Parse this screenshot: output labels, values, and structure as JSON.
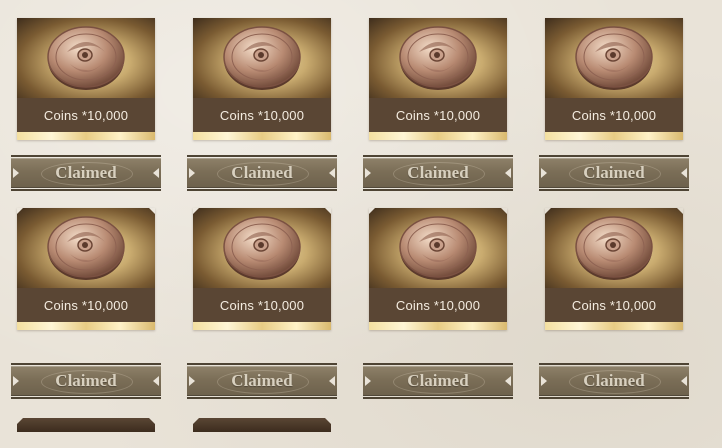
{
  "rewards": [
    {
      "label": "Coins *10,000",
      "status": "Claimed"
    },
    {
      "label": "Coins *10,000",
      "status": "Claimed"
    },
    {
      "label": "Coins *10,000",
      "status": "Claimed"
    },
    {
      "label": "Coins *10,000",
      "status": "Claimed"
    },
    {
      "label": "Coins *10,000",
      "status": "Claimed"
    },
    {
      "label": "Coins *10,000",
      "status": "Claimed"
    },
    {
      "label": "Coins *10,000",
      "status": "Claimed"
    },
    {
      "label": "Coins *10,000",
      "status": "Claimed"
    }
  ],
  "icons": {
    "reward": "coin-icon"
  },
  "colors": {
    "background": "#e9e3d8",
    "label_bar": "#5a4634",
    "claimed_button": "#7b6e57"
  }
}
